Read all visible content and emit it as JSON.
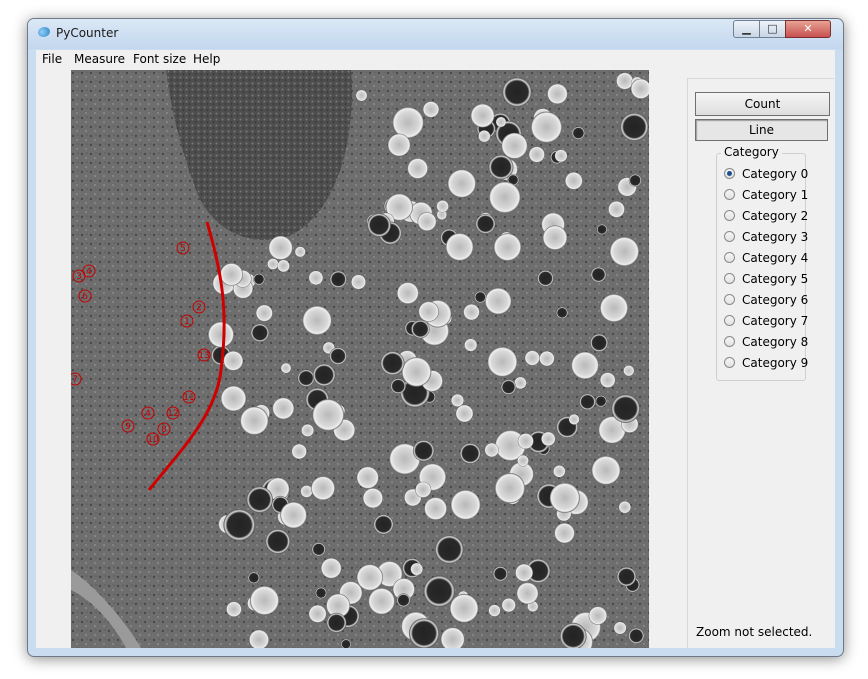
{
  "window": {
    "title": "PyCounter"
  },
  "menu": [
    "File",
    "Measure",
    "Font size",
    "Help"
  ],
  "panel": {
    "count_label": "Count",
    "line_label": "Line",
    "category_title": "Category",
    "categories": [
      "Category 0",
      "Category 1",
      "Category 2",
      "Category 3",
      "Category 4",
      "Category 5",
      "Category 6",
      "Category 7",
      "Category 8",
      "Category 9"
    ],
    "selected_category": "Category 0",
    "zoom_status": "Zoom not selected."
  },
  "image": {
    "markers": [
      "5",
      "3",
      "4",
      "6",
      "2",
      "1",
      "13",
      "7",
      "11",
      "4",
      "12",
      "9",
      "8",
      "10"
    ],
    "marker_color": "#c40000",
    "line_color": "#d00000"
  }
}
